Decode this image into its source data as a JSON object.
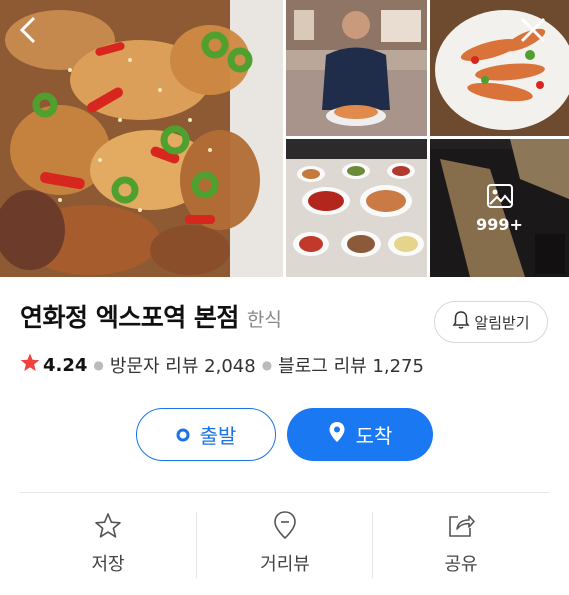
{
  "gallery": {
    "more_count": "999+",
    "icons": {
      "back": "chevron-left-icon",
      "close": "close-icon",
      "more": "image-icon"
    }
  },
  "place": {
    "name": "연화정 엑스포역 본점",
    "category": "한식",
    "alarm_label": "알림받기",
    "rating": "4.24",
    "visitor_reviews": "방문자 리뷰 2,048",
    "blog_reviews": "블로그 리뷰 1,275"
  },
  "actions": {
    "start_label": "출발",
    "destination_label": "도착"
  },
  "bottom_bar": {
    "save_label": "저장",
    "street_view_label": "거리뷰",
    "share_label": "공유"
  },
  "colors": {
    "accent": "#1a78f2",
    "star": "#f04040"
  }
}
